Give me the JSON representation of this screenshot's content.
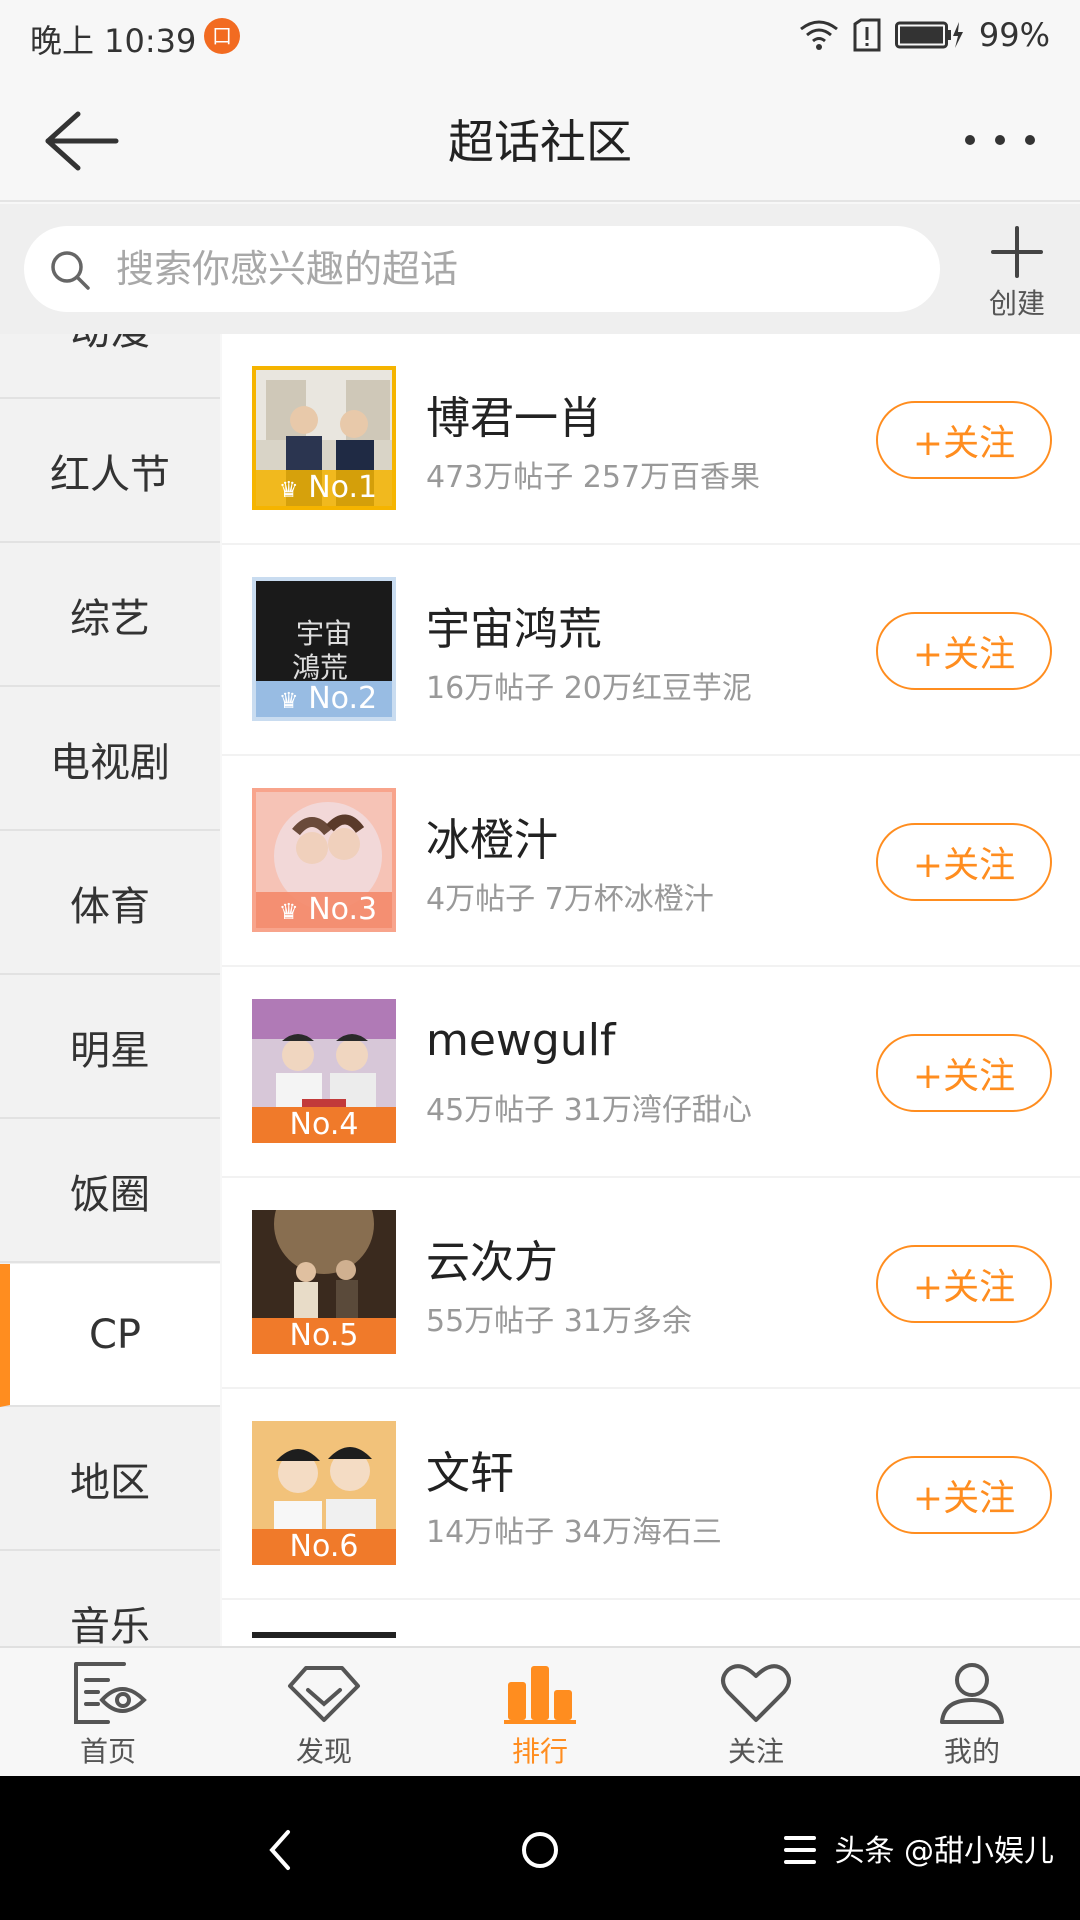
{
  "status_bar": {
    "time": "晚上 10:39",
    "notif_glyph": "口",
    "battery": "99%"
  },
  "header": {
    "title": "超话社区",
    "back_icon": "arrow-left-icon",
    "more_icon": "more-dots-icon"
  },
  "search": {
    "placeholder": "搜索你感兴趣的超话",
    "create_label": "创建"
  },
  "sidebar": {
    "partial_top_label": "动漫",
    "items": [
      {
        "label": "红人节"
      },
      {
        "label": "综艺"
      },
      {
        "label": "电视剧"
      },
      {
        "label": "体育"
      },
      {
        "label": "明星"
      },
      {
        "label": "饭圈"
      },
      {
        "label": "CP",
        "active": true
      },
      {
        "label": "地区"
      },
      {
        "label": "音乐"
      }
    ]
  },
  "rankings": [
    {
      "rank": "No.1",
      "name": "博君一肖",
      "stats": "473万帖子 257万百香果",
      "follow": "+关注",
      "badge_color": "#f5b400"
    },
    {
      "rank": "No.2",
      "name": "宇宙鸿荒",
      "stats": "16万帖子 20万红豆芋泥",
      "follow": "+关注",
      "badge_color": "#8fb6e0"
    },
    {
      "rank": "No.3",
      "name": "冰橙汁",
      "stats": "4万帖子 7万杯冰橙汁",
      "follow": "+关注",
      "badge_color": "#f48a6a"
    },
    {
      "rank": "No.4",
      "name": "mewgulf",
      "stats": "45万帖子 31万湾仔甜心",
      "follow": "+关注",
      "badge_color": "#f07a2a"
    },
    {
      "rank": "No.5",
      "name": "云次方",
      "stats": "55万帖子 31万多余",
      "follow": "+关注",
      "badge_color": "#f07a2a"
    },
    {
      "rank": "No.6",
      "name": "文轩",
      "stats": "14万帖子 34万海石三",
      "follow": "+关注",
      "badge_color": "#f07a2a"
    }
  ],
  "tabbar": {
    "items": [
      {
        "label": "首页",
        "icon": "home-eye-icon"
      },
      {
        "label": "发现",
        "icon": "discover-diamond-icon"
      },
      {
        "label": "排行",
        "icon": "ranking-bars-icon",
        "active": true
      },
      {
        "label": "关注",
        "icon": "heart-icon"
      },
      {
        "label": "我的",
        "icon": "profile-icon"
      }
    ]
  },
  "navbar": {
    "watermark": "头条 @甜小娱儿"
  },
  "colors": {
    "accent": "#ff8d1f",
    "background": "#f7f7f7"
  }
}
